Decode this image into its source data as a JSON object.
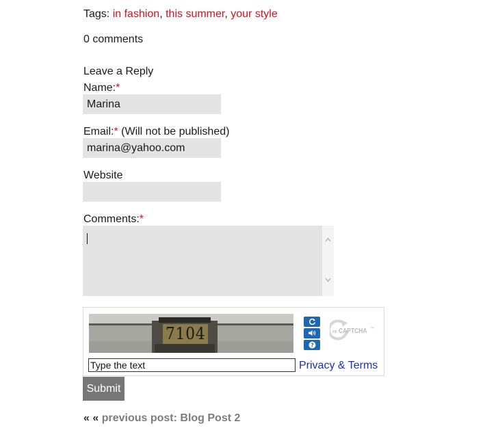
{
  "tags": {
    "label": "Tags:",
    "items": [
      "in fashion",
      "this summer",
      "your style"
    ],
    "separator": ","
  },
  "comments_count": "0 comments",
  "reply_form": {
    "heading": "Leave a Reply",
    "name": {
      "label": "Name:",
      "required_mark": "*",
      "value": "Marina"
    },
    "email": {
      "label": "Email:",
      "required_mark": "*",
      "note": "(Will not be published)",
      "value": "marina@yahoo.com"
    },
    "website": {
      "label": "Website",
      "value": ""
    },
    "comments": {
      "label": "Comments:",
      "required_mark": "*",
      "value": ""
    },
    "captcha": {
      "input_placeholder": "Type the text",
      "privacy_link": "Privacy & Terms",
      "image_text": "7104",
      "logo_prefix": "re",
      "logo_text": "CAPTCHA",
      "logo_tm": "™"
    },
    "submit_label": "Submit"
  },
  "navigation": {
    "arrows": "« «",
    "previous_post": "previous post: Blog Post 2"
  },
  "colors": {
    "tag_link": "#d4101d",
    "required": "#d4101d",
    "field_bg": "#e3e3e3",
    "submit_bg": "#767676",
    "privacy_link": "#1b2fb8",
    "nav_link": "#7d7d7d"
  }
}
